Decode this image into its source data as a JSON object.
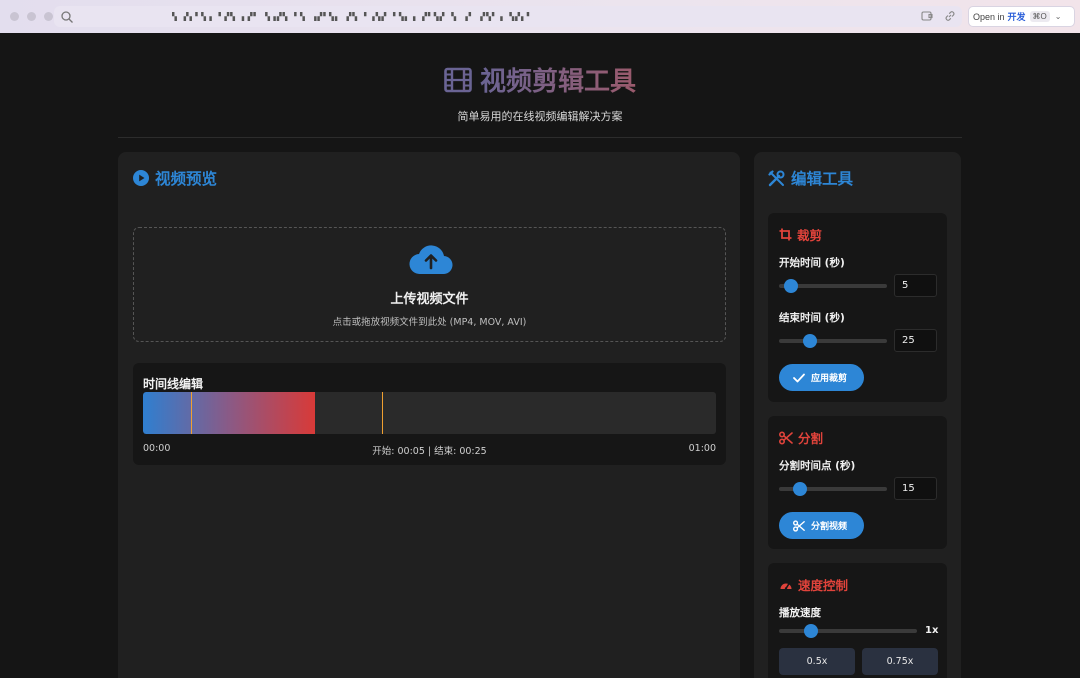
{
  "browser": {
    "url": "▚ ▞▖▘▚▗ ▘▞▚ ▖▞▘ ▚▗▞▚ ▘▚ ▗▞▘▚▖ ▞▚ ▘▗▚▞ ▘▚▖▗ ▞▘▚▞ ▚ ▗▘ ▞▚▘▗ ▚▞▖▘",
    "open_in_prefix": "Open in",
    "open_in_app": "开发",
    "open_in_shortcut": "⌘O",
    "open_in_caret": "⌄"
  },
  "header": {
    "title": "视频剪辑工具",
    "subtitle": "简单易用的在线视频编辑解决方案"
  },
  "preview": {
    "title": "视频预览",
    "upload_title": "上传视频文件",
    "upload_hint": "点击或拖放视频文件到此处 (MP4, MOV, AVI)"
  },
  "timeline": {
    "title": "时间线编辑",
    "start_label": "00:00",
    "range_label": "开始: 00:05 | 结束: 00:25",
    "end_label": "01:00",
    "range_start_fraction": 0.0833,
    "range_end_fraction": 0.4167,
    "fill_fraction": 0.3
  },
  "tools": {
    "title": "编辑工具",
    "crop": {
      "title": "裁剪",
      "start_label": "开始时间 (秒)",
      "start_value": "5",
      "start_fraction": 0.05,
      "end_label": "结束时间 (秒)",
      "end_value": "25",
      "end_fraction": 0.25,
      "apply_label": "应用裁剪"
    },
    "split": {
      "title": "分割",
      "point_label": "分割时间点 (秒)",
      "point_value": "15",
      "point_fraction": 0.15,
      "button_label": "分割视频"
    },
    "speed": {
      "title": "速度控制",
      "label": "播放速度",
      "value": "1x",
      "fraction": 0.2,
      "presets": [
        "0.5x",
        "0.75x"
      ]
    }
  },
  "colors": {
    "accent_blue": "#2d86d6",
    "accent_red": "#e0433b",
    "background": "#151515",
    "panel": "#202020"
  }
}
